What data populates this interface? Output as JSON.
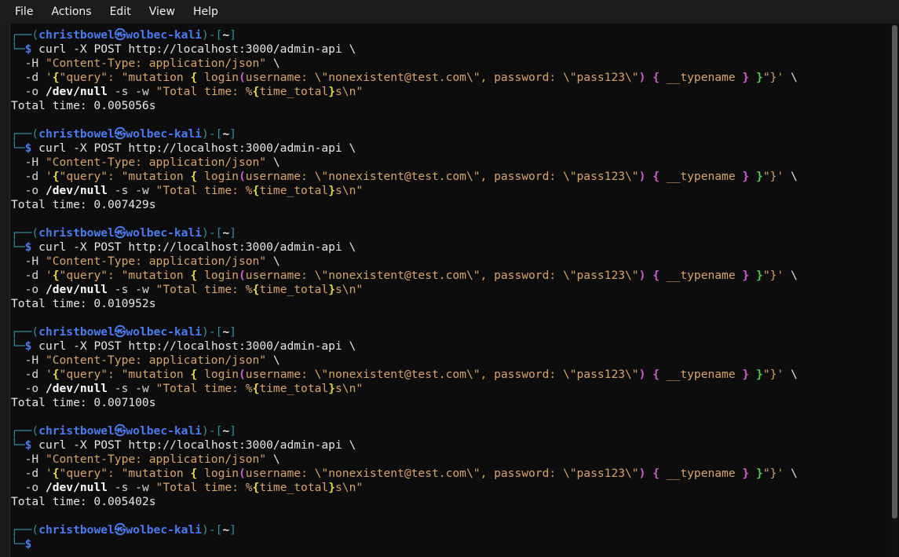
{
  "menubar": {
    "items": [
      "File",
      "Actions",
      "Edit",
      "View",
      "Help"
    ]
  },
  "prompt": {
    "user": "christbowel",
    "at": "㉿",
    "host": "wolbec-kali",
    "dir": "~",
    "symbol": "$"
  },
  "command": {
    "line1": "curl -X POST http://localhost:3000/admin-api \\",
    "header_flag": "-H",
    "header_value": "\"Content-Type: application/json\"",
    "data_flag": "-d",
    "payload_prefix": "'",
    "payload_key": "\"query\": \"mutation ",
    "payload_login": "login",
    "payload_args": "username: \\\"nonexistent@test.com\\\", password: \\\"pass123\\\"",
    "payload_field": "__typename",
    "payload_end": "\"}'",
    "output_flag": "-o",
    "output_path": "/dev/null",
    "silent_flags": "-s -w",
    "format_string": "\"Total time: %",
    "format_var": "time_total",
    "format_end": "s\\n\""
  },
  "results": [
    "Total time: 0.005056s",
    "Total time: 0.007429s",
    "Total time: 0.010952s",
    "Total time: 0.007100s",
    "Total time: 0.005402s"
  ]
}
